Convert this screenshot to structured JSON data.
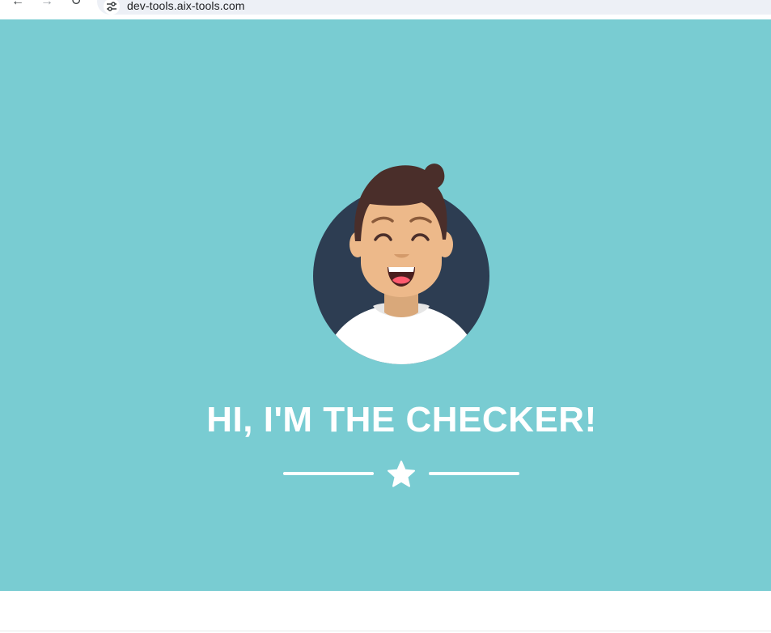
{
  "browser": {
    "url": "dev-tools.aix-tools.com",
    "back_icon": "arrow-left-icon",
    "forward_icon": "arrow-right-icon",
    "reload_icon": "reload-icon",
    "site_info_icon": "tune-icon"
  },
  "hero": {
    "background_color": "#79ccd2",
    "title": "HI, I'M THE CHECKER!",
    "avatar_icon": "smiling-person-avatar",
    "divider_icon": "star-icon"
  },
  "colors": {
    "hero_text": "#ffffff",
    "avatar_circle": "#2d3d52",
    "skin": "#edb98a",
    "hair": "#4a2e2a"
  }
}
